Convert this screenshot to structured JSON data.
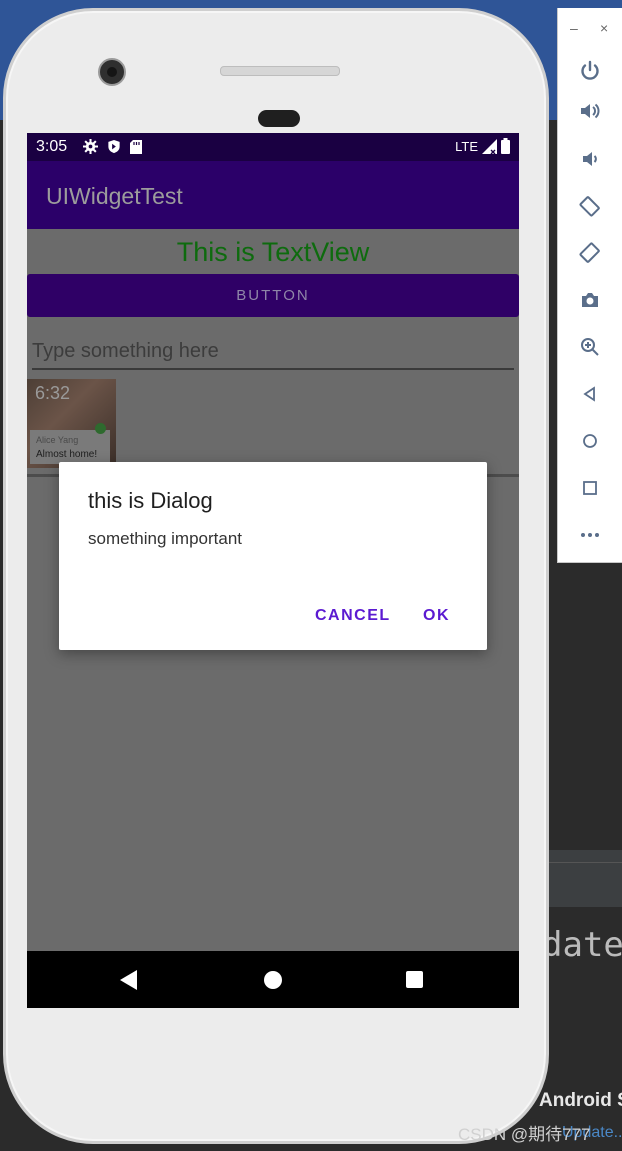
{
  "status_bar": {
    "time": "3:05",
    "network": "LTE"
  },
  "app": {
    "title": "UIWidgetTest",
    "text_view": "This is TextView",
    "button_label": "BUTTON",
    "edit_placeholder": "Type something here",
    "image": {
      "time": "6:32",
      "name": "Alice Yang",
      "message": "Almost home!"
    }
  },
  "dialog": {
    "title": "this is Dialog",
    "message": "something important",
    "cancel_label": "CANCEL",
    "ok_label": "OK"
  },
  "ide": {
    "code_fragment": "date",
    "panel_title": "Android S",
    "link_text": "Update...",
    "watermark": "CSDN @期待777"
  },
  "colors": {
    "accent": "#5b1ad1",
    "app_bar": "#2b0069",
    "text_view": "#0e6b0e"
  },
  "emulator_toolbar": {
    "icons": [
      "power-icon",
      "volume-up-icon",
      "volume-down-icon",
      "rotate-left-icon",
      "rotate-right-icon",
      "camera-icon",
      "zoom-icon",
      "back-icon",
      "home-icon",
      "overview-icon",
      "more-icon"
    ]
  }
}
